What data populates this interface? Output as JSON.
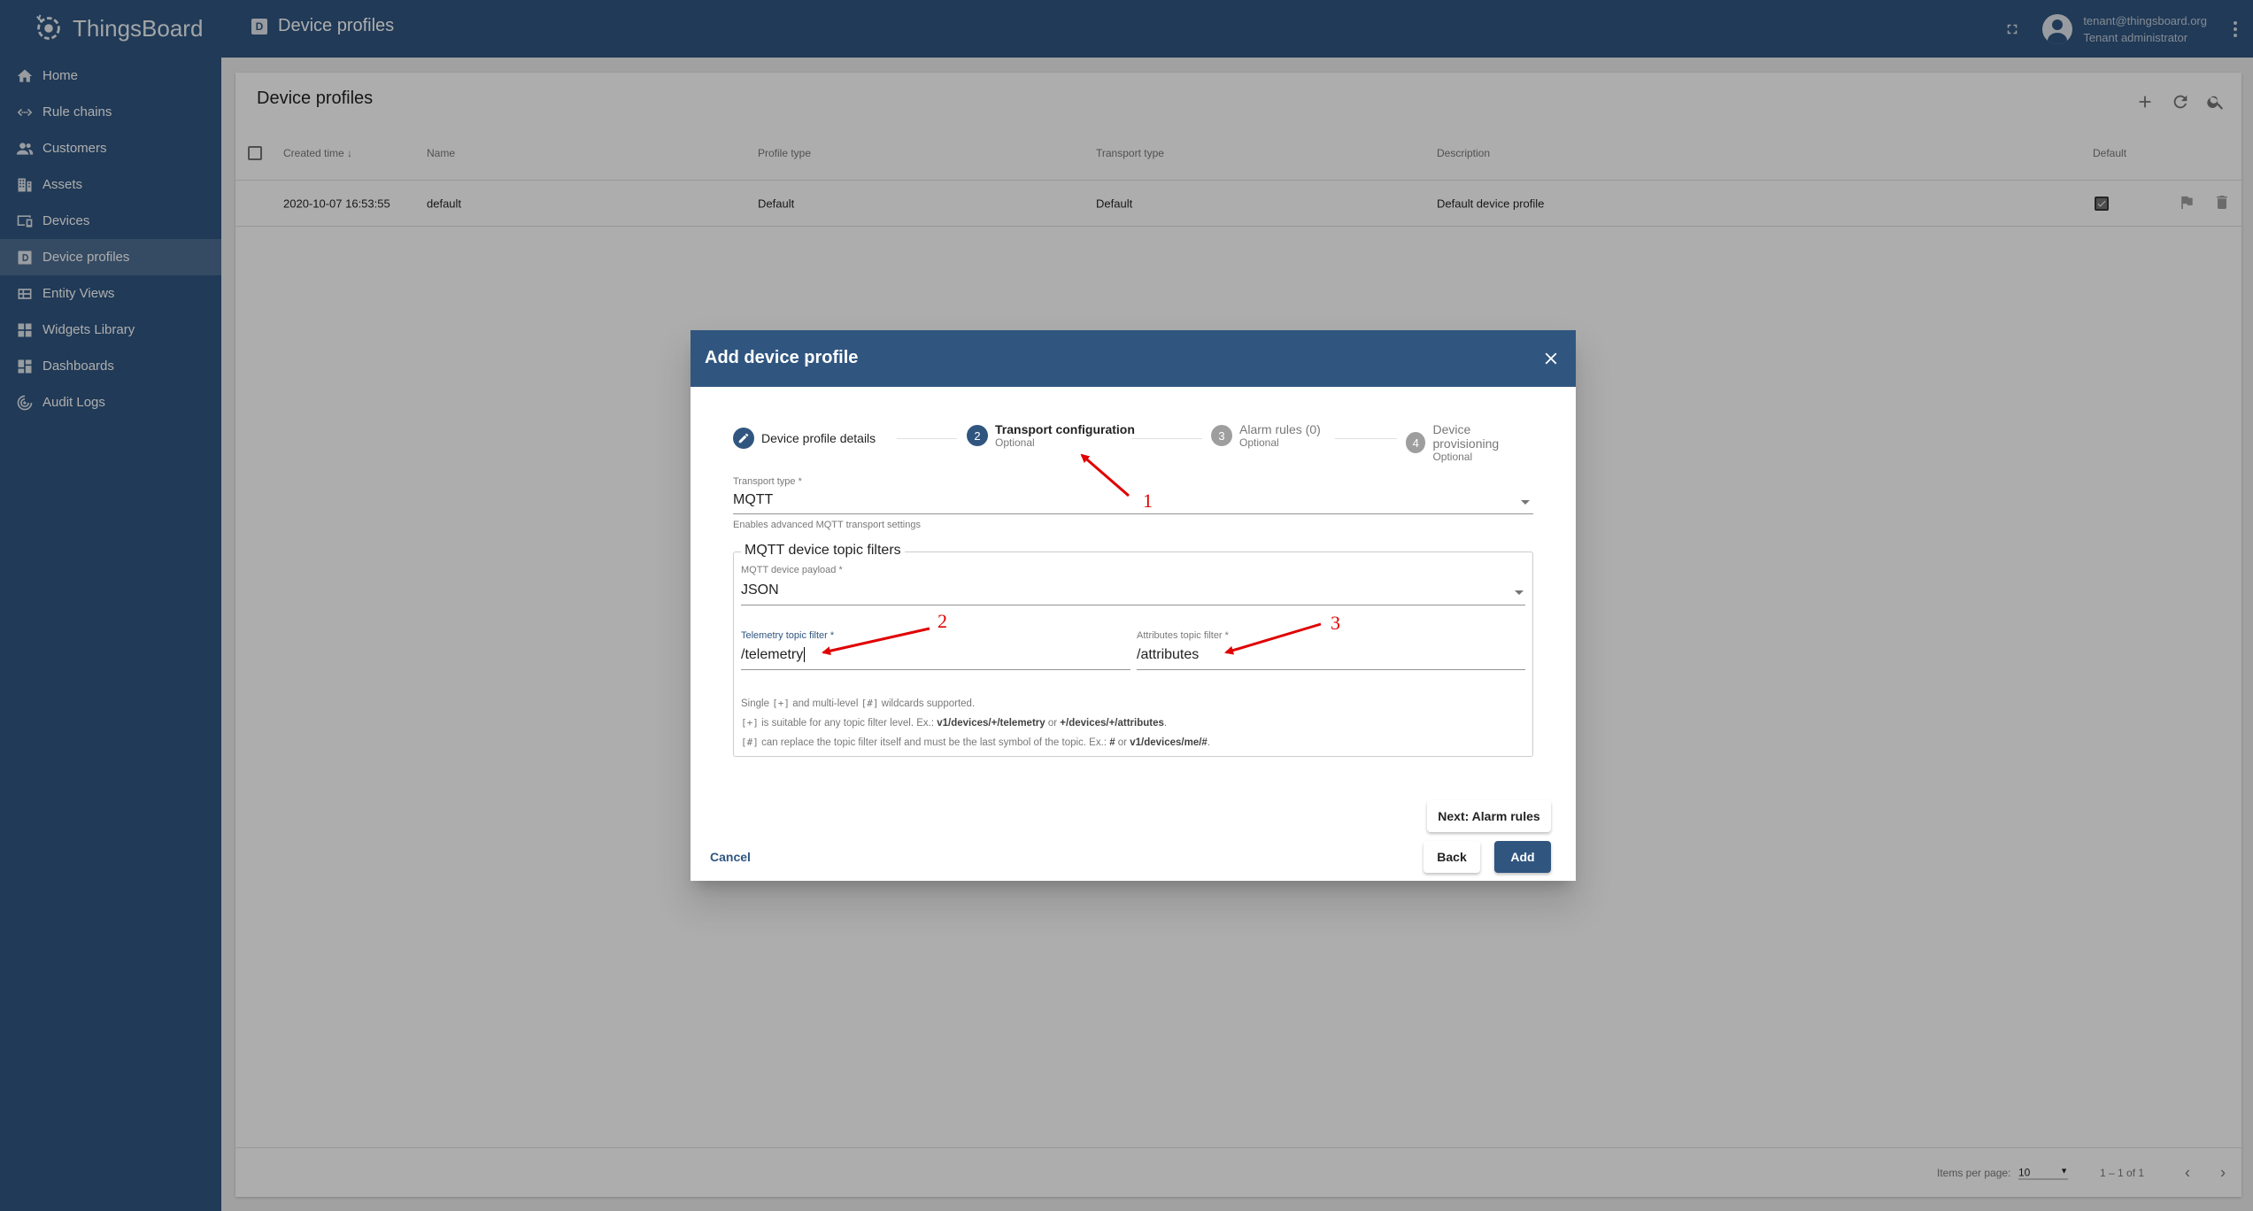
{
  "app": {
    "name": "ThingsBoard",
    "page_title": "Device profiles"
  },
  "user": {
    "email": "tenant@thingsboard.org",
    "role": "Tenant administrator"
  },
  "sidebar": {
    "items": [
      {
        "label": "Home",
        "icon": "home-icon"
      },
      {
        "label": "Rule chains",
        "icon": "rule-chains-icon"
      },
      {
        "label": "Customers",
        "icon": "customers-icon"
      },
      {
        "label": "Assets",
        "icon": "assets-icon"
      },
      {
        "label": "Devices",
        "icon": "devices-icon"
      },
      {
        "label": "Device profiles",
        "icon": "device-profiles-icon",
        "active": true
      },
      {
        "label": "Entity Views",
        "icon": "entity-views-icon"
      },
      {
        "label": "Widgets Library",
        "icon": "widgets-icon"
      },
      {
        "label": "Dashboards",
        "icon": "dashboards-icon"
      },
      {
        "label": "Audit Logs",
        "icon": "audit-logs-icon"
      }
    ]
  },
  "table": {
    "title": "Device profiles",
    "columns": [
      "Created time",
      "Name",
      "Profile type",
      "Transport type",
      "Description",
      "Default"
    ],
    "rows": [
      {
        "created": "2020-10-07 16:53:55",
        "name": "default",
        "profile_type": "Default",
        "transport_type": "Default",
        "description": "Default device profile",
        "default": true
      }
    ]
  },
  "paginator": {
    "items_per_page_label": "Items per page:",
    "items_per_page": "10",
    "range": "1 – 1 of 1"
  },
  "dialog": {
    "title": "Add device profile",
    "steps": [
      {
        "num": "1",
        "label": "Device profile details",
        "sub": "",
        "state": "done"
      },
      {
        "num": "2",
        "label": "Transport configuration",
        "sub": "Optional",
        "state": "active"
      },
      {
        "num": "3",
        "label": "Alarm rules (0)",
        "sub": "Optional",
        "state": "pending"
      },
      {
        "num": "4",
        "label": "Device provisioning",
        "sub": "Optional",
        "state": "pending"
      }
    ],
    "transport_type": {
      "label": "Transport type *",
      "value": "MQTT",
      "hint": "Enables advanced MQTT transport settings"
    },
    "mqtt": {
      "legend": "MQTT device topic filters",
      "payload": {
        "label": "MQTT device payload *",
        "value": "JSON"
      },
      "telemetry": {
        "label": "Telemetry topic filter *",
        "value": "/telemetry"
      },
      "attributes": {
        "label": "Attributes topic filter *",
        "value": "/attributes"
      },
      "help": {
        "l1_a": "Single ",
        "l1_b": "[+]",
        "l1_c": " and multi-level ",
        "l1_d": "[#]",
        "l1_e": " wildcards supported.",
        "l2_a": "[+]",
        "l2_b": " is suitable for any topic filter level. Ex.: ",
        "l2_c": "v1/devices/+/telemetry",
        "l2_d": " or ",
        "l2_e": "+/devices/+/attributes",
        "l2_f": ".",
        "l3_a": "[#]",
        "l3_b": " can replace the topic filter itself and must be the last symbol of the topic. Ex.: ",
        "l3_c": "#",
        "l3_d": " or ",
        "l3_e": "v1/devices/me/#",
        "l3_f": "."
      }
    },
    "buttons": {
      "next": "Next: Alarm rules",
      "cancel": "Cancel",
      "back": "Back",
      "add": "Add"
    }
  },
  "annotations": [
    "1",
    "2",
    "3"
  ],
  "colors": {
    "primary": "#305680",
    "annotation": "#e00000"
  }
}
